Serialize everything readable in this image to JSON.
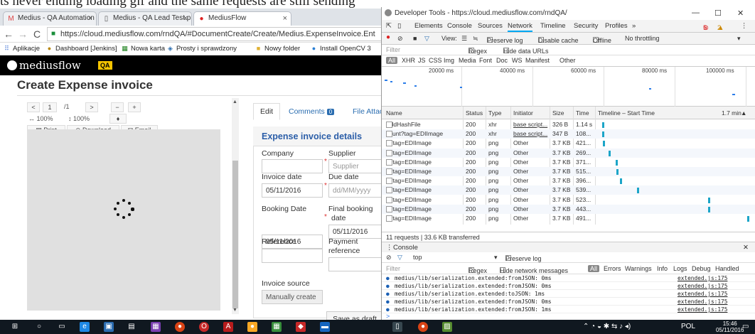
{
  "caption": "ts never ending loading gif and the same requests are still sending",
  "browser": {
    "tabs": [
      {
        "label": "Medius - QA Automation",
        "icon": "gmail-icon"
      },
      {
        "label": "Medius - QA Lead Test.p",
        "icon": "document-icon"
      },
      {
        "label": "MediusFlow",
        "icon": "mediusflow-icon"
      }
    ],
    "url": "https://cloud.mediusflow.com/rndQA/#DocumentCreate/Create/Medius.ExpenseInvoice.Ent",
    "bookmarks": [
      "Aplikacje",
      "Dashboard [Jenkins]",
      "Nowa karta",
      "Prosty i sprawdzony",
      "Nowy folder",
      "Install OpenCV 3"
    ]
  },
  "app": {
    "logo": "mediusflow",
    "env_badge": "QA",
    "page_title": "Create Expense invoice",
    "viewer": {
      "page_current": "1",
      "page_total": "/1",
      "zoom_width": "100%",
      "zoom_height": "100%",
      "print": "Print",
      "download": "Download",
      "email": "Email"
    },
    "tabs": {
      "edit": "Edit",
      "comments": "Comments",
      "comments_count": "0",
      "attachments": "File Attac"
    },
    "section_title": "Expense invoice details",
    "fields": {
      "company_label": "Company",
      "supplier_label": "Supplier",
      "supplier_placeholder": "Supplier",
      "invoice_date_label": "Invoice date",
      "invoice_date": "05/11/2016",
      "due_date_label": "Due date",
      "due_date_placeholder": "dd/MM/yyyy",
      "booking_date_label": "Booking Date",
      "booking_date": "05/11/2016",
      "final_booking_label_1": "Final booking",
      "final_booking_label_2": "date",
      "final_booking_date": "05/11/2016",
      "reference_label": "Reference",
      "payment_ref_label_1": "Payment",
      "payment_ref_label_2": "reference",
      "invoice_source_label": "Invoice source",
      "invoice_source_value": "Manually create"
    },
    "save_as_draft": "Save as draft"
  },
  "devtools": {
    "window_title": "Developer Tools - https://cloud.mediusflow.com/rndQA/",
    "panel_tabs": [
      "Elements",
      "Console",
      "Sources",
      "Network",
      "Timeline",
      "Security",
      "Profiles",
      "»"
    ],
    "error_count": "5",
    "warning_count": "2",
    "network_toolbar": {
      "view": "View:",
      "preserve_log": "Preserve log",
      "disable_cache": "Disable cache",
      "offline": "Offline",
      "throttling": "No throttling"
    },
    "filter_placeholder": "Filter",
    "regex": "Regex",
    "hide_data_urls": "Hide data URLs",
    "type_filters": [
      "All",
      "XHR",
      "JS",
      "CSS",
      "Img",
      "Media",
      "Font",
      "Doc",
      "WS",
      "Manifest",
      "Other"
    ],
    "overview_ticks": [
      "20000 ms",
      "40000 ms",
      "60000 ms",
      "80000 ms",
      "100000 ms"
    ],
    "columns": [
      "Name",
      "Status",
      "Type",
      "Initiator",
      "Size",
      "Time",
      "Timeline – Start Time",
      "1.7 min"
    ],
    "requests": [
      {
        "name": "AddHashFile",
        "status": "200",
        "type": "xhr",
        "initiator": "base script...",
        "size": "326 B",
        "time": "1.14 s",
        "start": 0.02
      },
      {
        "name": "count?tag=EDIImage",
        "status": "200",
        "type": "xhr",
        "initiator": "base script...",
        "size": "347 B",
        "time": "108...",
        "start": 0.02
      },
      {
        "name": "1?tag=EDIImage",
        "status": "200",
        "type": "png",
        "initiator": "Other",
        "size": "3.7 KB",
        "time": "421...",
        "start": 0.025
      },
      {
        "name": "1?tag=EDIImage",
        "status": "200",
        "type": "png",
        "initiator": "Other",
        "size": "3.7 KB",
        "time": "269...",
        "start": 0.06
      },
      {
        "name": "1?tag=EDIImage",
        "status": "200",
        "type": "png",
        "initiator": "Other",
        "size": "3.7 KB",
        "time": "371...",
        "start": 0.11
      },
      {
        "name": "1?tag=EDIImage",
        "status": "200",
        "type": "png",
        "initiator": "Other",
        "size": "3.7 KB",
        "time": "515...",
        "start": 0.115
      },
      {
        "name": "1?tag=EDIImage",
        "status": "200",
        "type": "png",
        "initiator": "Other",
        "size": "3.7 KB",
        "time": "396...",
        "start": 0.14
      },
      {
        "name": "1?tag=EDIImage",
        "status": "200",
        "type": "png",
        "initiator": "Other",
        "size": "3.7 KB",
        "time": "539...",
        "start": 0.25
      },
      {
        "name": "1?tag=EDIImage",
        "status": "200",
        "type": "png",
        "initiator": "Other",
        "size": "3.7 KB",
        "time": "523...",
        "start": 0.73
      },
      {
        "name": "1?tag=EDIImage",
        "status": "200",
        "type": "png",
        "initiator": "Other",
        "size": "3.7 KB",
        "time": "443...",
        "start": 0.73
      },
      {
        "name": "1?tag=EDIImage",
        "status": "200",
        "type": "png",
        "initiator": "Other",
        "size": "3.7 KB",
        "time": "491...",
        "start": 0.99
      }
    ],
    "summary": "11 requests  |  33.6 KB transferred",
    "console": {
      "title": "Console",
      "context": "top",
      "preserve_log": "Preserve log",
      "filter_placeholder": "Filter",
      "regex": "Regex",
      "hide_network": "Hide network messages",
      "levels": [
        "All",
        "Errors",
        "Warnings",
        "Info",
        "Logs",
        "Debug",
        "Handled"
      ],
      "messages": [
        {
          "text": "medius/lib/serialization.extended:fromJSON: 0ms",
          "source": "extended.js:175"
        },
        {
          "text": "medius/lib/serialization.extended:fromJSON: 0ms",
          "source": "extended.js:175"
        },
        {
          "text": "medius/lib/serialization.extended:toJSON: 1ms",
          "source": "extended.js:175"
        },
        {
          "text": "medius/lib/serialization.extended:fromJSON: 0ms",
          "source": "extended.js:175"
        },
        {
          "text": "medius/lib/serialization.extended:fromJSON: 1ms",
          "source": "extended.js:175"
        }
      ]
    }
  },
  "taskbar": {
    "language": "POL",
    "time": "15:46",
    "date": "05/11/2016"
  }
}
